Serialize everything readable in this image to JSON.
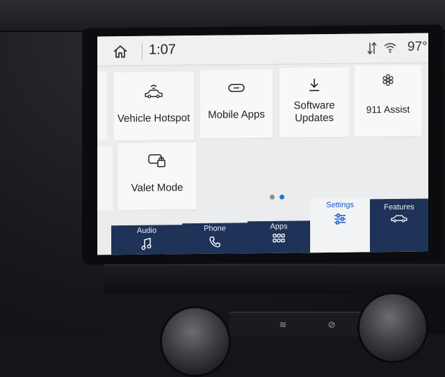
{
  "status_bar": {
    "time": "1:07",
    "temperature": "97°"
  },
  "tiles": [
    {
      "label": "Vehicle Hotspot",
      "icon": "car-wifi-icon"
    },
    {
      "label": "Mobile Apps",
      "icon": "link-icon"
    },
    {
      "label": "Software Updates",
      "icon": "download-icon"
    },
    {
      "label": "911 Assist",
      "icon": "star-of-life-icon"
    },
    {
      "label": "Valet Mode",
      "icon": "valet-lock-icon"
    }
  ],
  "pager": {
    "current": 2,
    "total": 2
  },
  "nav": {
    "items": [
      {
        "label": "Audio",
        "icon": "music-note-icon"
      },
      {
        "label": "Phone",
        "icon": "phone-icon"
      },
      {
        "label": "Apps",
        "icon": "apps-grid-icon"
      },
      {
        "label": "Settings",
        "icon": "settings-sliders-icon",
        "active": true
      },
      {
        "label": "Features",
        "icon": "vehicle-icon"
      }
    ]
  },
  "colors": {
    "nav_bg": "#1f3358",
    "accent": "#1a57c7",
    "tile_bg": "#f7f8f8",
    "screen_bg": "#eaeced"
  }
}
